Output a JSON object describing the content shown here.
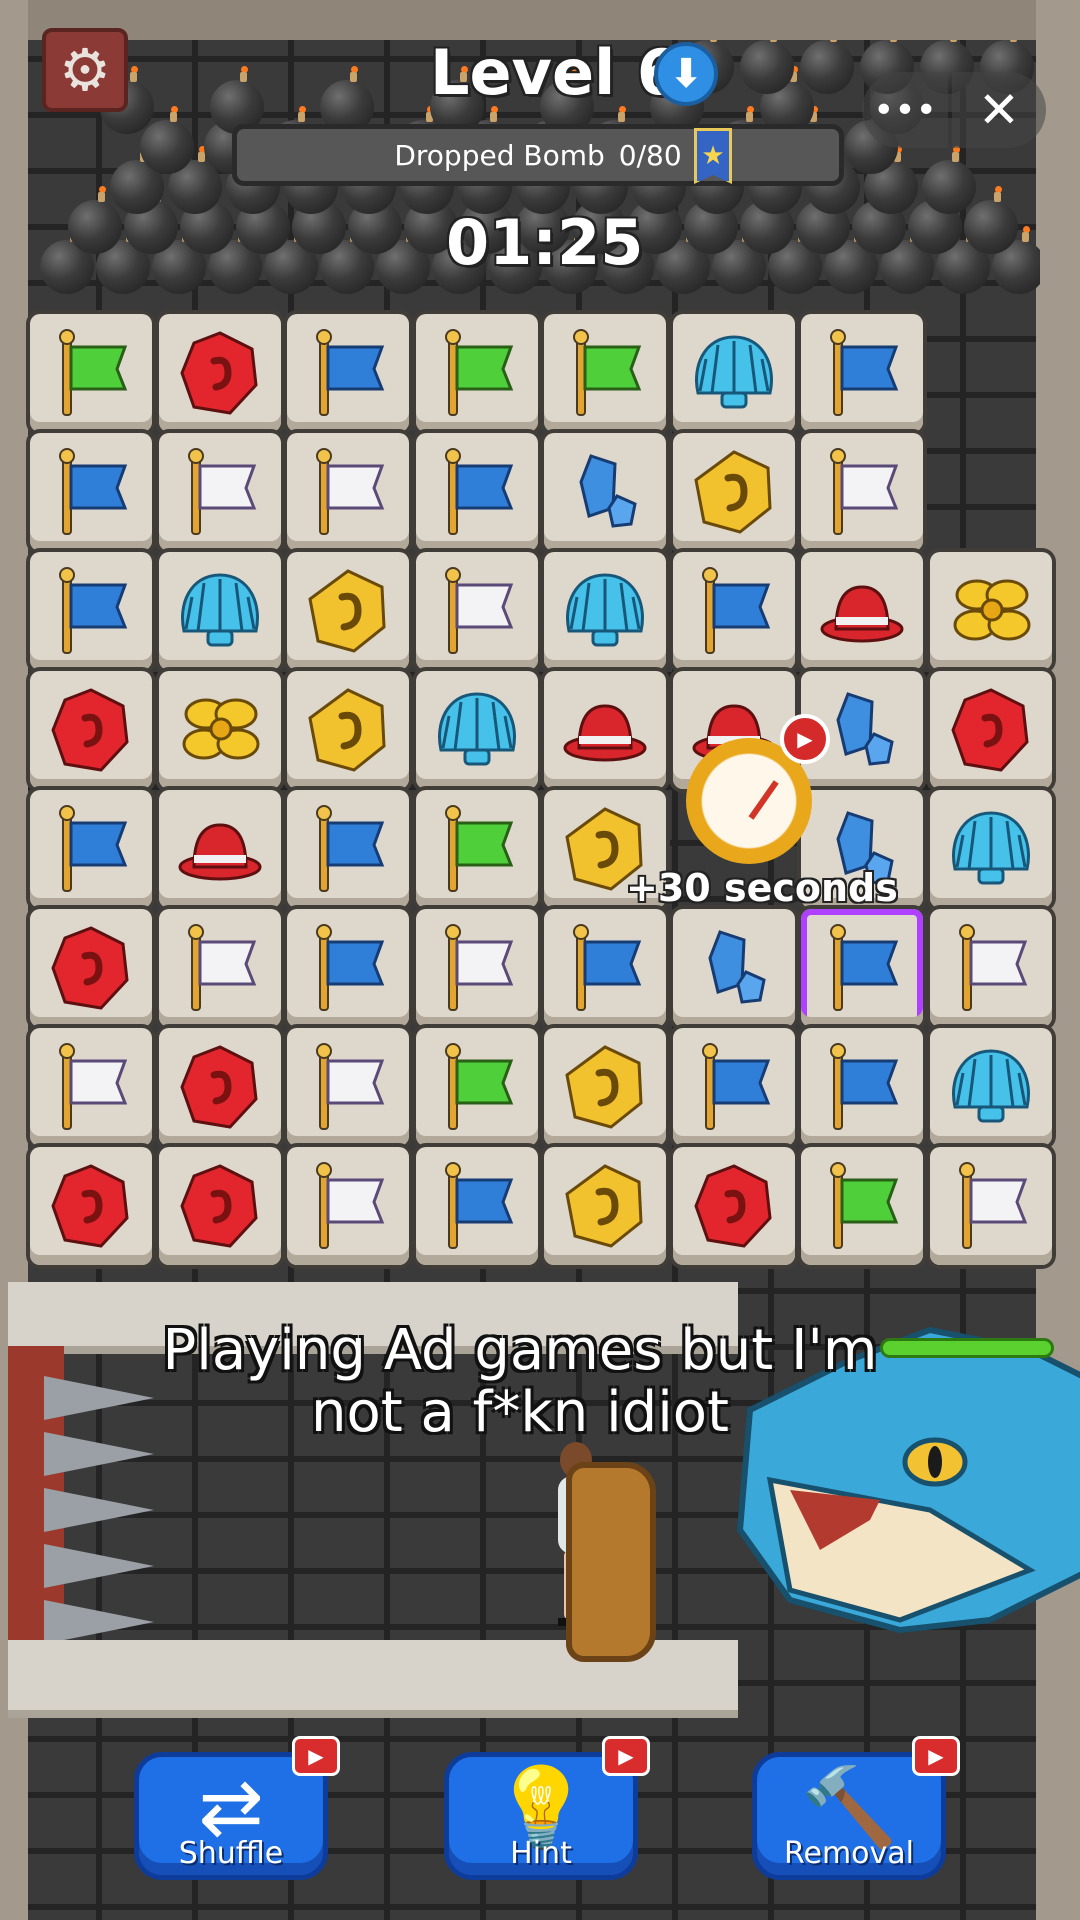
{
  "header": {
    "level_label": "Level 6",
    "level_icon": "down-arrow-icon",
    "settings_icon": "gear-icon",
    "more_label": "•••",
    "close_label": "✕"
  },
  "bomb_progress": {
    "label": "Dropped Bomb",
    "count": "0/80",
    "badge_icon": "star-ribbon-icon"
  },
  "timer": "01:25",
  "bonus": {
    "text": "+30 seconds",
    "icon": "stopwatch-icon",
    "video_icon": "video-ad-icon"
  },
  "board": {
    "rows": [
      [
        "green-flag",
        "red-gem",
        "blue-flag",
        "green-flag",
        "green-flag",
        "shell",
        "blue-flag",
        ""
      ],
      [
        "blue-flag",
        "white-flag",
        "white-flag",
        "blue-flag",
        "blue-crystal",
        "gold-coin",
        "white-flag",
        ""
      ],
      [
        "blue-flag",
        "shell",
        "gold-coin",
        "white-flag",
        "shell",
        "blue-flag",
        "red-hat",
        "yellow-flower"
      ],
      [
        "red-gem",
        "yellow-flower",
        "gold-coin",
        "shell",
        "red-hat",
        "red-hat",
        "blue-crystal",
        "red-gem"
      ],
      [
        "blue-flag",
        "red-hat",
        "blue-flag",
        "green-flag",
        "gold-coin",
        "",
        "blue-crystal",
        "shell"
      ],
      [
        "red-gem",
        "white-flag",
        "blue-flag",
        "white-flag",
        "blue-flag",
        "blue-crystal",
        "blue-flag",
        "white-flag"
      ],
      [
        "white-flag",
        "red-gem",
        "white-flag",
        "green-flag",
        "gold-coin",
        "blue-flag",
        "blue-flag",
        "shell"
      ],
      [
        "red-gem",
        "red-gem",
        "white-flag",
        "blue-flag",
        "gold-coin",
        "red-gem",
        "green-flag",
        "white-flag"
      ]
    ],
    "selected": "row 6, column 7"
  },
  "caption": {
    "line1": "Playing Ad games but I'm",
    "line2": "not a f*kn idiot"
  },
  "tools": [
    {
      "label": "Shuffle",
      "icon": "shuffle-icon"
    },
    {
      "label": "Hint",
      "icon": "lightbulb-icon"
    },
    {
      "label": "Removal",
      "icon": "hammer-icon"
    }
  ],
  "colors": {
    "tool_button": "#1f6fe6",
    "settings_button": "#8b3a36",
    "health_bar": "#5ad12e",
    "selected_outline": "#b040ff"
  }
}
